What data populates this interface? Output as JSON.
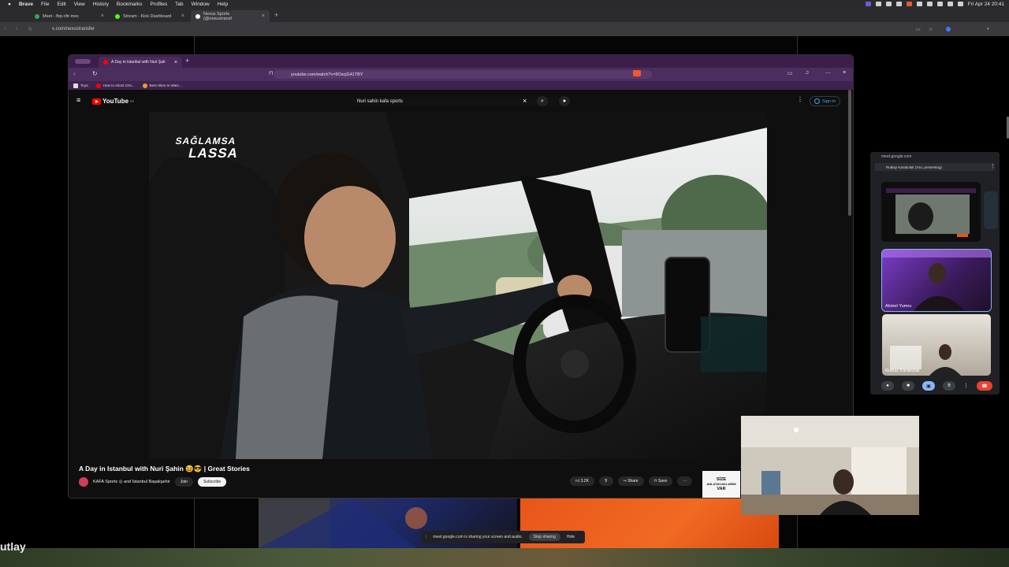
{
  "menubar": {
    "app": "Brave",
    "items": [
      "File",
      "Edit",
      "View",
      "History",
      "Bookmarks",
      "Profiles",
      "Tab",
      "Window",
      "Help"
    ],
    "clock": "Fri Apr 24  20:41"
  },
  "outer_browser": {
    "tabs": [
      {
        "title": "Meet - fbp-cfir-mec",
        "color": "#34a853"
      },
      {
        "title": "Stream - Kick Dashboard",
        "color": "#53fc18"
      },
      {
        "title": "Nexus Sports (@nexustransf",
        "color": "#ffffff"
      }
    ],
    "url": "x.com/nexustransfer"
  },
  "inner_browser": {
    "tab_title": "A Day in Istanbul with Nuri Şah",
    "url": "youtube.com/watch?v=9OscjG41TBY",
    "bookmarks": [
      "Toya",
      "How to shoot CIN...",
      "Best Sites to Watc..."
    ]
  },
  "youtube": {
    "search_query": "Nuri sahin kafa sports",
    "logo": "YouTube",
    "logo_region": "RS",
    "signin": "Sign in",
    "video_title": "A Day in Istanbul with Nuri Şahin 😆😎 | Great Stories",
    "channel": "KAFA Sports ◎ and İstanbul Başakşehir",
    "join": "Join",
    "subscribe": "Subscribe",
    "likes": "3.2K",
    "share": "Share",
    "save": "Save",
    "overlay_line1": "SAĞLAMSA",
    "overlay_line2": "LASSA",
    "ad_text": [
      "SİZE",
      "ANLATACAKLARIM",
      "VAR"
    ]
  },
  "meet": {
    "domain": "meet.google.com",
    "presenter": "Rutkay Karabulak (You, presenting)",
    "participants": [
      "Ahmet Yumru",
      "Rutkay Karabulak"
    ],
    "accent": "#8ab4f8",
    "end_color": "#ea4335"
  },
  "sharebar": {
    "message": "meet.google.com is sharing your screen and audio.",
    "stop": "Stop sharing",
    "hide": "Hide"
  },
  "background": {
    "partial_text": "utlay"
  }
}
